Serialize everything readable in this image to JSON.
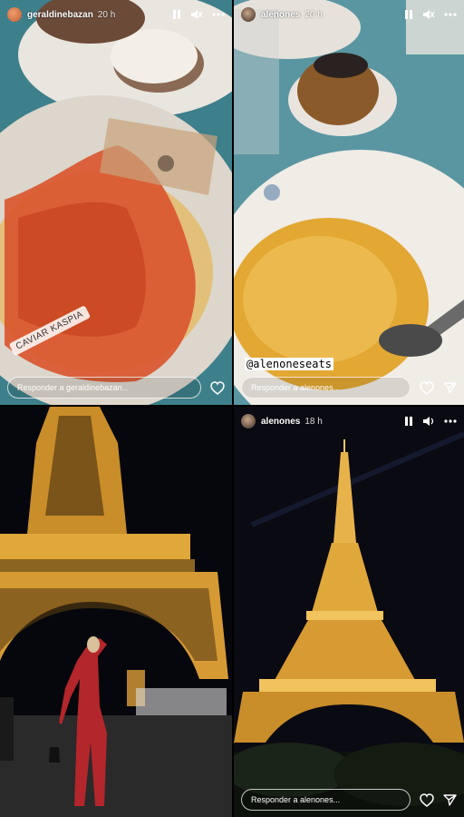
{
  "stories": [
    {
      "username": "geraldinebazan",
      "time": "20 h",
      "reply_placeholder": "Responder a geraldinebazan...",
      "sticker": "CAVIAR KASPIA",
      "icons": [
        "pause-icon",
        "mute-icon",
        "more-icon",
        "heart-icon"
      ]
    },
    {
      "username": "alenones",
      "time": "20 h",
      "reply_placeholder": "Responder a alenones...",
      "mention": "@alenoneseats",
      "icons": [
        "pause-icon",
        "mute-icon",
        "more-icon",
        "heart-icon",
        "send-icon"
      ]
    },
    {
      "username": "",
      "time": "",
      "icons": []
    },
    {
      "username": "alenones",
      "time": "18 h",
      "reply_placeholder": "Responder a alenones...",
      "icons": [
        "pause-icon",
        "volume-icon",
        "more-icon",
        "heart-icon",
        "send-icon"
      ]
    }
  ],
  "colors": {
    "accent_white": "#ffffff",
    "tablecloth": "#4b8a96",
    "tower_gold": "#e0a83a",
    "night_sky": "#0a0a12",
    "dress_red": "#b3262b"
  }
}
